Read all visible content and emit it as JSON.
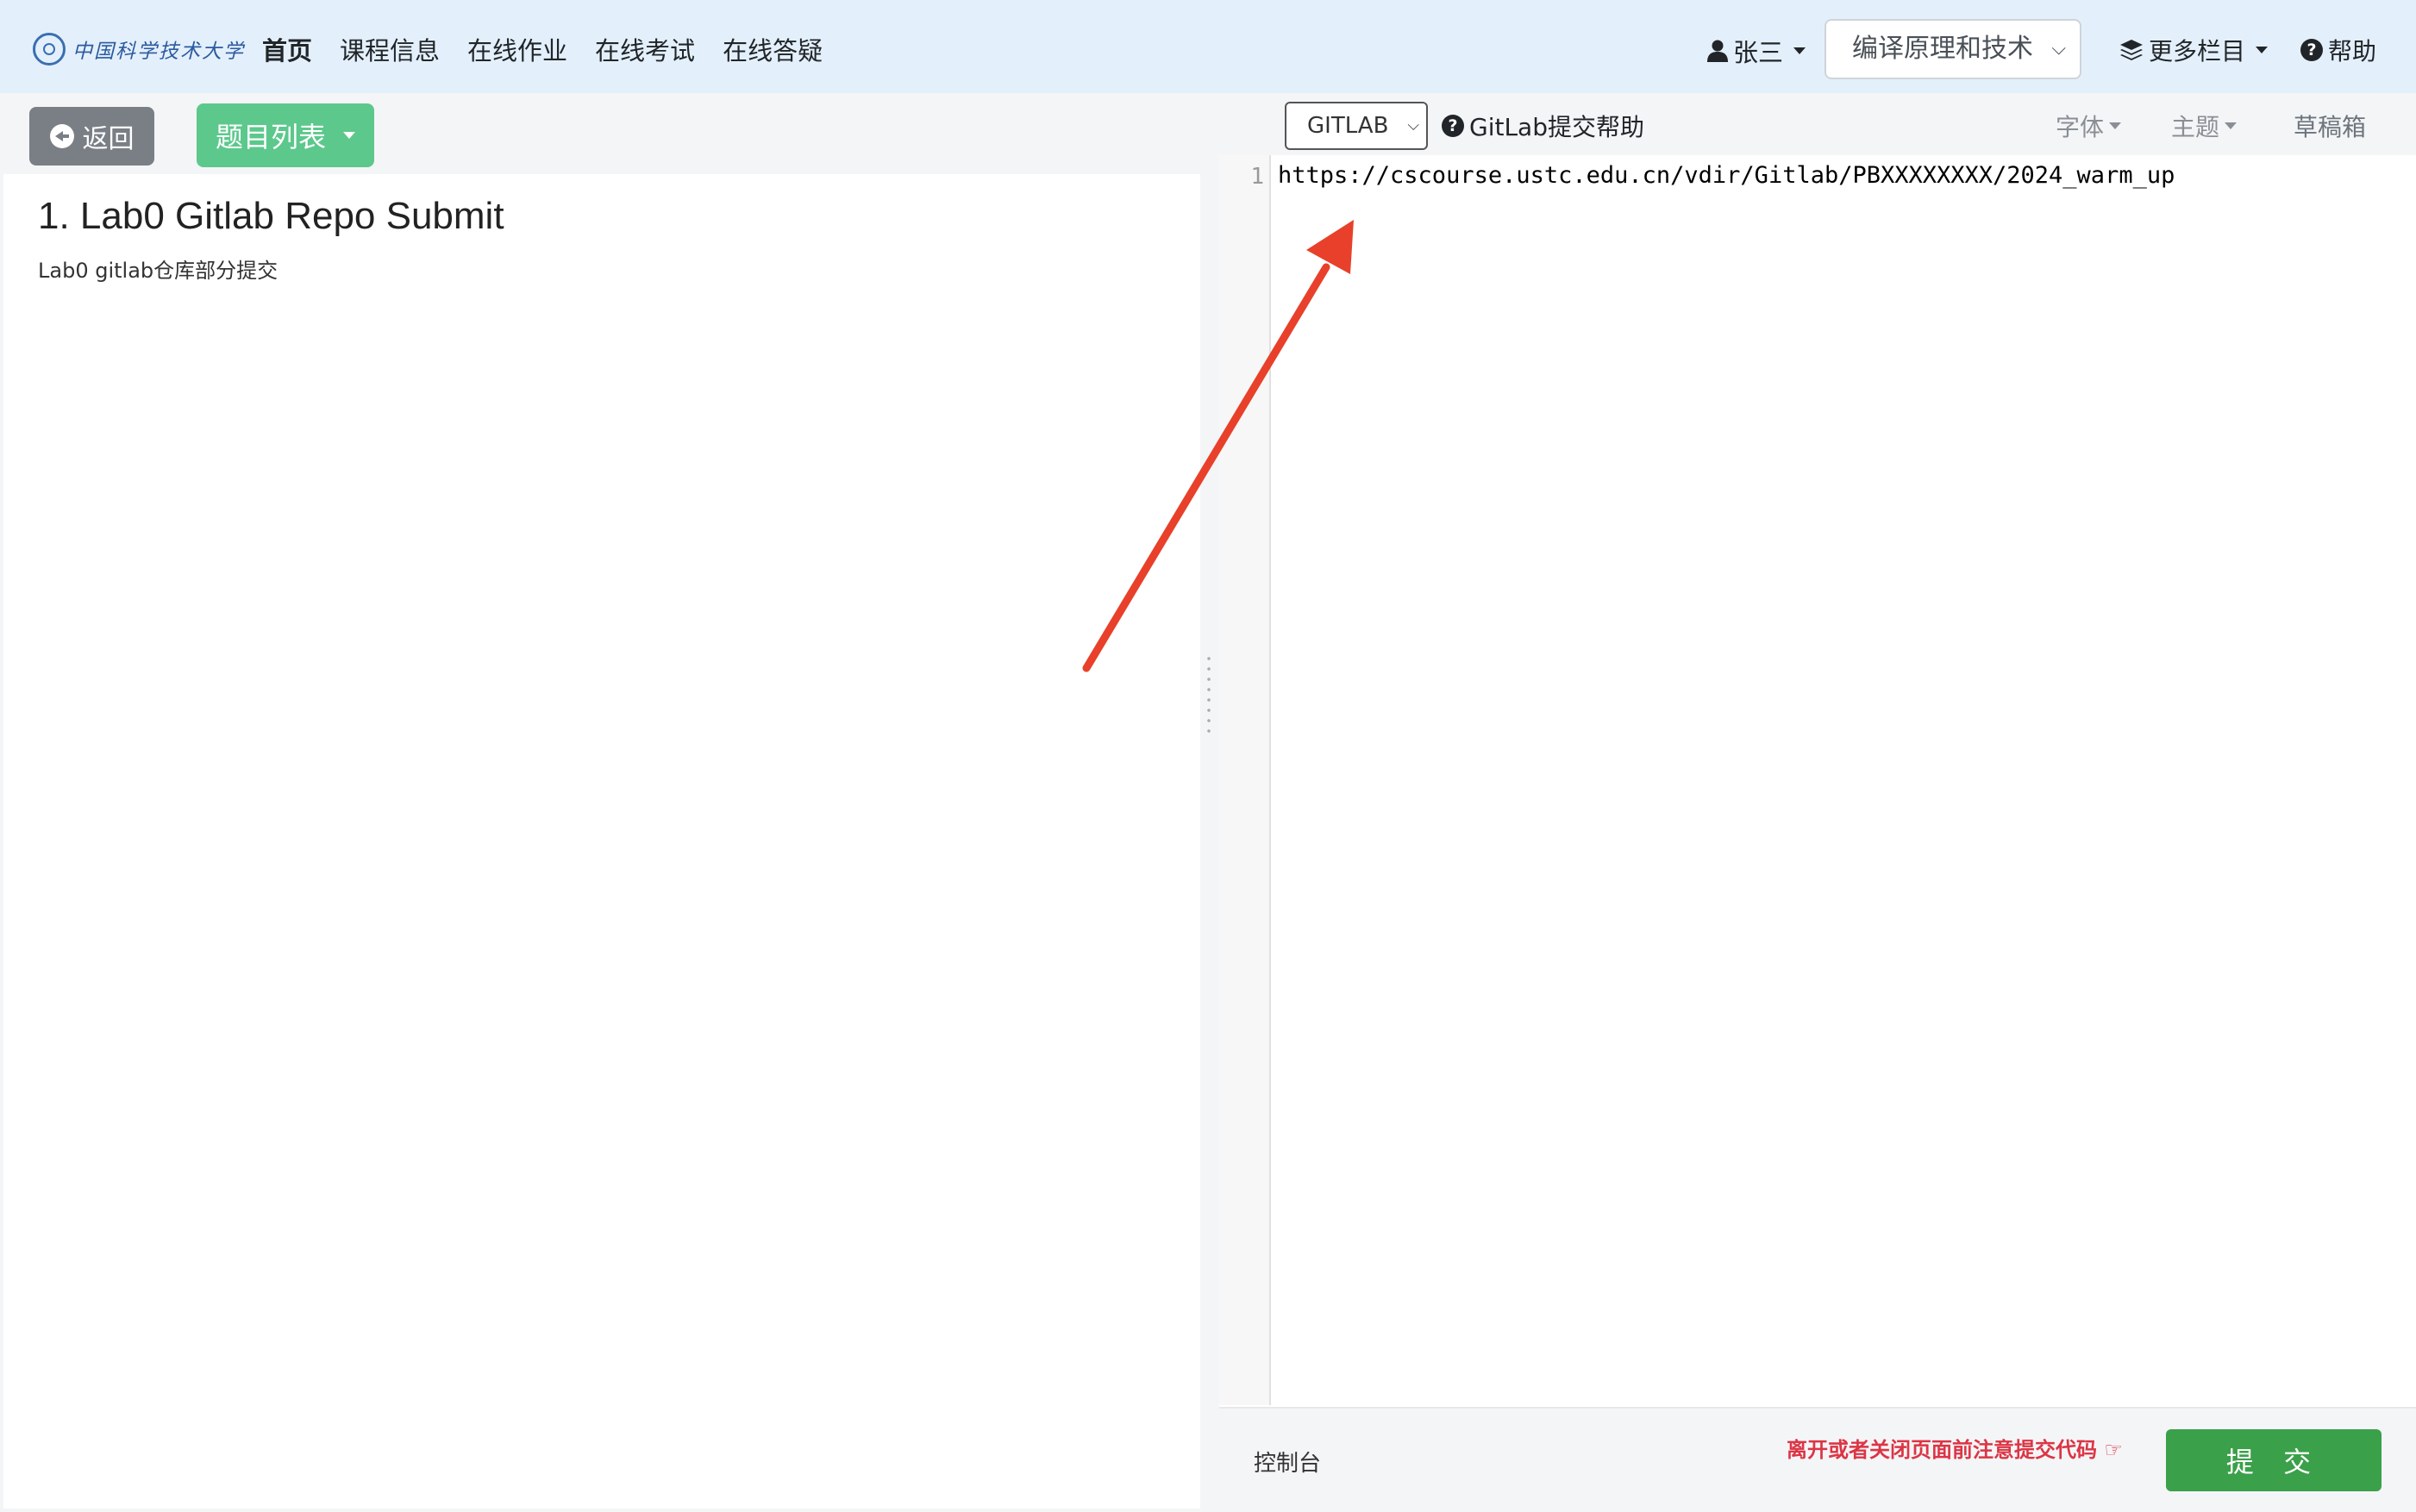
{
  "navbar": {
    "logo_text": "中国科学技术大学",
    "links": [
      "首页",
      "课程信息",
      "在线作业",
      "在线考试",
      "在线答疑"
    ],
    "user_name": "张三",
    "course_selected": "编译原理和技术",
    "more_menu": "更多栏目",
    "help": "帮助"
  },
  "left": {
    "back_label": "返回",
    "problem_list_label": "题目列表",
    "problem_title": "1. Lab0 Gitlab Repo Submit",
    "problem_desc": "Lab0 gitlab仓库部分提交"
  },
  "right": {
    "language": "GITLAB",
    "gitlab_help": "GitLab提交帮助",
    "font_menu": "字体",
    "theme_menu": "主题",
    "draft_link": "草稿箱",
    "editor_lines": [
      {
        "number": "1",
        "text": "https://cscourse.ustc.edu.cn/vdir/Gitlab/PBXXXXXXXX/2024_warm_up"
      }
    ],
    "console_label": "控制台",
    "warning_text": "离开或者关闭页面前注意提交代码",
    "submit_label": "提 交"
  },
  "colors": {
    "navbar_bg": "#e3f0fb",
    "problem_list_btn": "#5cc88c",
    "submit_btn": "#3aa04a",
    "warning": "#dc3545",
    "annotation_arrow": "#e8402a"
  },
  "icons": [
    "user-icon",
    "layers-icon",
    "question-circle-icon",
    "arrow-circle-left-icon",
    "hand-pointer-icon"
  ]
}
